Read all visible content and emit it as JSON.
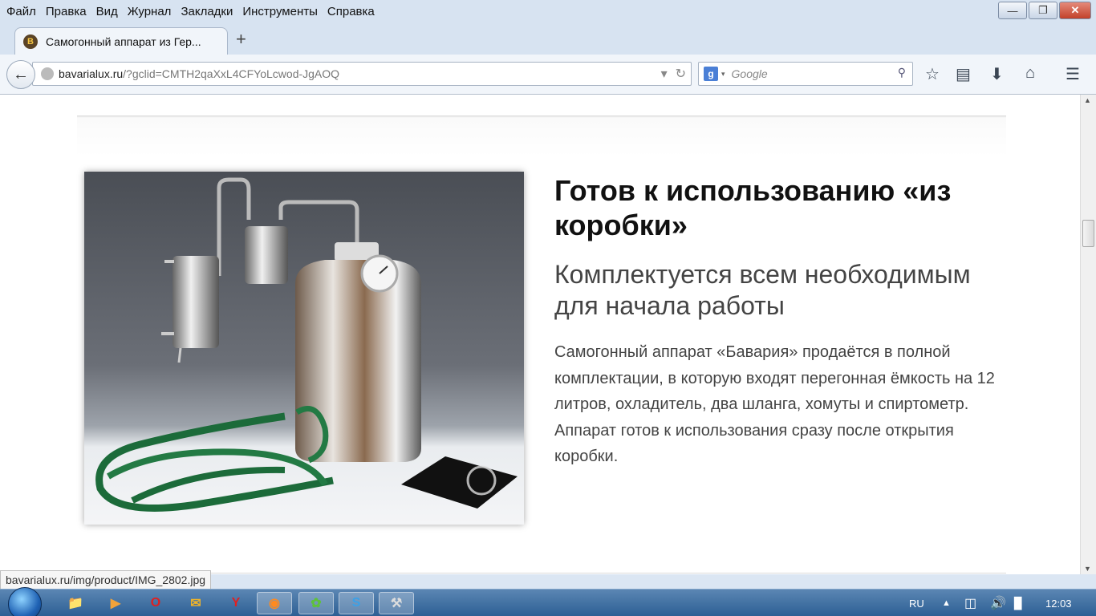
{
  "menu": [
    "Файл",
    "Правка",
    "Вид",
    "Журнал",
    "Закладки",
    "Инструменты",
    "Справка"
  ],
  "tab": {
    "title": "Самогонный аппарат из Гер...",
    "favicon_letter": "B",
    "new_tab_symbol": "+"
  },
  "address": {
    "host": "bavarialux.ru",
    "path": "/?gclid=CMTH2qaXxL4CFYoLcwod-JgAOQ"
  },
  "search": {
    "placeholder": "Google",
    "engine_letter": "g"
  },
  "toolbar_icons": [
    "bookmark-star-icon",
    "reading-list-icon",
    "download-icon",
    "home-icon",
    "menu-icon"
  ],
  "content": {
    "heading": "Готов к использованию «из коробки»",
    "subheading": "Комплектуется всем необходимым для начала работы",
    "body": "Самогонный аппарат «Бавария» продаётся в полной комплектации, в которую входят перегонная ёмкость на 12 литров, охладитель, два шланга, хомуты и спиртометр. Аппарат готов к использования сразу после открытия коробки."
  },
  "status_url": "bavarialux.ru/img/product/IMG_2802.jpg",
  "taskbar": {
    "apps": [
      "explorer-icon",
      "media-player-icon",
      "opera-icon",
      "outlook-icon",
      "yandex-icon",
      "firefox-icon",
      "icq-icon",
      "skype-icon",
      "tool-icon"
    ],
    "lang": "RU",
    "time": "12:03"
  },
  "colors": {
    "titlebar": "#d7e3f1",
    "taskbar": "#2d5f94",
    "heading": "#111111",
    "text": "#444444"
  }
}
